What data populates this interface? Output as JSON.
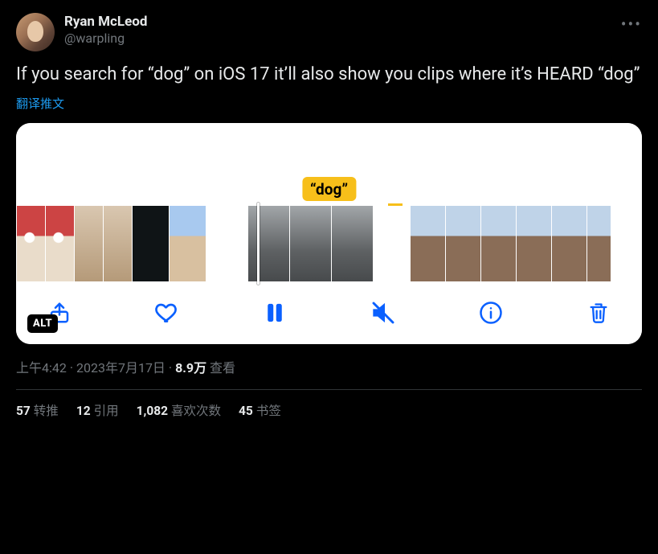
{
  "author": {
    "display_name": "Ryan McLeod",
    "handle": "@warpling"
  },
  "body": "If you search for “dog” on iOS 17 it’ll also show you clips where it’s HEARD “dog”",
  "translate_label": "翻译推文",
  "media": {
    "keyword_tag": "“dog”",
    "alt_badge": "ALT"
  },
  "meta": {
    "time": "上午4:42",
    "sep1": " · ",
    "date": "2023年7月17日",
    "sep2": " · ",
    "views_count": "8.9万",
    "views_label": " 查看"
  },
  "stats": {
    "retweets_n": "57",
    "retweets_l": "转推",
    "quotes_n": "12",
    "quotes_l": "引用",
    "likes_n": "1,082",
    "likes_l": "喜欢次数",
    "bookmarks_n": "45",
    "bookmarks_l": "书签"
  }
}
